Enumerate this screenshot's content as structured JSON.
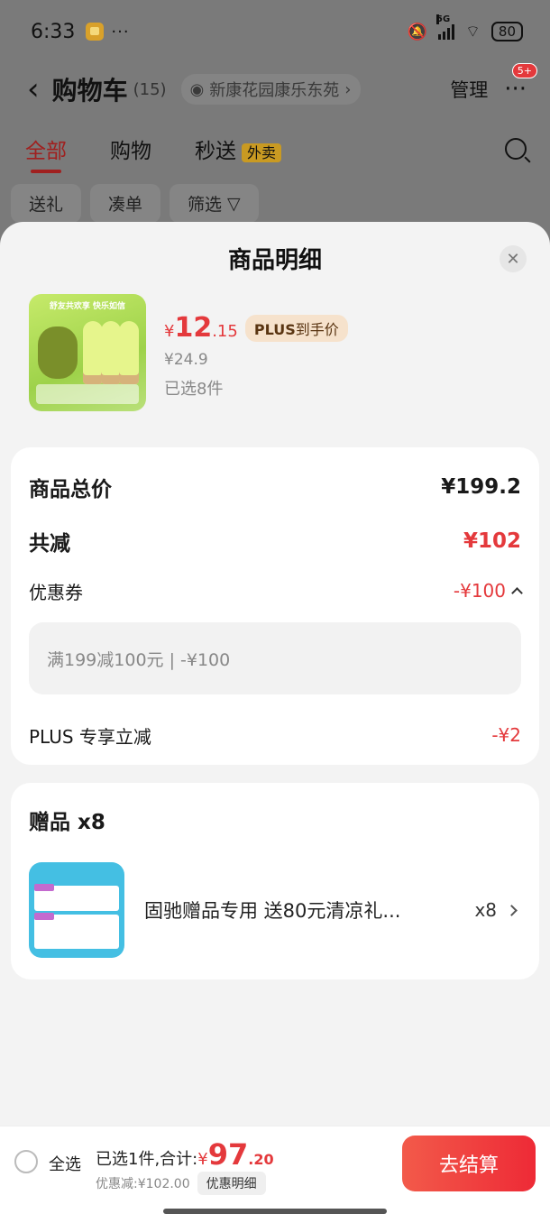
{
  "status_bar": {
    "time": "6:33",
    "more": "···",
    "network": "5G",
    "battery": "80"
  },
  "nav": {
    "back": "‹",
    "title": "购物车",
    "count": "(15)",
    "address": "新康花园康乐东苑",
    "manage": "管理",
    "more": "···",
    "badge": "5+"
  },
  "tabs": [
    {
      "label": "全部"
    },
    {
      "label": "购物"
    },
    {
      "label": "秒送"
    }
  ],
  "tab_pill": "外卖",
  "chips": [
    {
      "label": "送礼"
    },
    {
      "label": "凑单"
    },
    {
      "label": "筛选"
    }
  ],
  "sheet": {
    "title": "商品明细",
    "product": {
      "price_symbol": "¥",
      "price_int": "12",
      "price_dec": ".15",
      "plus_tag_bold": "PLUS",
      "plus_tag_text": "到手价",
      "original_price": "¥24.9",
      "selected": "已选8件",
      "image_banner": "舒友共欢享 快乐如信"
    },
    "summary": {
      "total_label": "商品总价",
      "total_value": "¥199.2",
      "reduce_label": "共减",
      "reduce_value": "¥102",
      "coupon_label": "优惠券",
      "coupon_value": "-¥100",
      "coupon_detail": "满199减100元 | -¥100",
      "plus_label": "PLUS 专享立减",
      "plus_value": "-¥2"
    },
    "gifts": {
      "title": "赠品 x8",
      "name": "固驰赠品专用  送80元清凉礼...",
      "qty": "x8"
    }
  },
  "bottom": {
    "select_all": "全选",
    "total_prefix": "已选1件,合计:",
    "total_symbol": "¥",
    "total_int": "97",
    "total_dec": ".20",
    "discount": "优惠减:¥102.00",
    "discount_detail": "优惠明细",
    "checkout": "去结算"
  },
  "colors": {
    "accent": "#e4393c",
    "checkout_start": "#f25a4a",
    "checkout_end": "#ee2a36",
    "plus_tag_bg": "#f6e2cc"
  }
}
